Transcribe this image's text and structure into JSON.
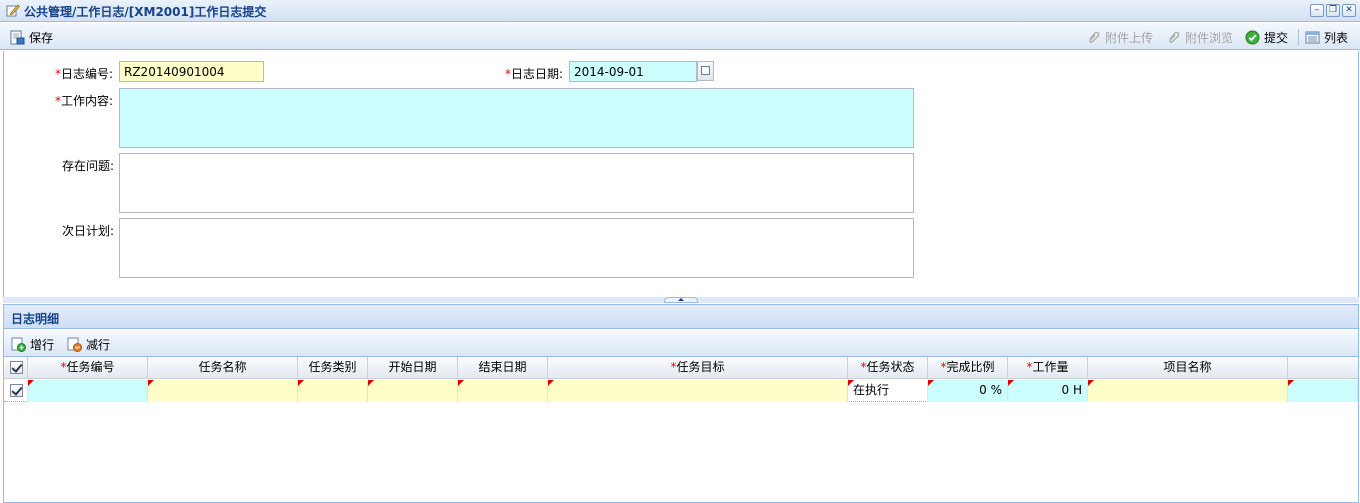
{
  "window": {
    "title": "公共管理/工作日志/[XM2001]工作日志提交"
  },
  "toolbar": {
    "save": "保存",
    "attach_upload": "附件上传",
    "attach_browse": "附件浏览",
    "submit": "提交",
    "list": "列表"
  },
  "form": {
    "log_no": {
      "label": "日志编号:",
      "value": "RZ20140901004"
    },
    "log_date": {
      "label": "日志日期:",
      "value": "2014-09-01"
    },
    "work_content": {
      "label": "工作内容:",
      "value": ""
    },
    "issues": {
      "label": "存在问题:",
      "value": ""
    },
    "next_plan": {
      "label": "次日计划:",
      "value": ""
    }
  },
  "detail": {
    "title": "日志明细",
    "add_row": "增行",
    "del_row": "减行",
    "columns": [
      {
        "label": "任务编号",
        "required": true
      },
      {
        "label": "任务名称",
        "required": false
      },
      {
        "label": "任务类别",
        "required": false
      },
      {
        "label": "开始日期",
        "required": false
      },
      {
        "label": "结束日期",
        "required": false
      },
      {
        "label": "任务目标",
        "required": true
      },
      {
        "label": "任务状态",
        "required": true
      },
      {
        "label": "完成比例",
        "required": true
      },
      {
        "label": "工作量",
        "required": true
      },
      {
        "label": "项目名称",
        "required": false
      }
    ],
    "rows": [
      {
        "checked": true,
        "cells": [
          "",
          "",
          "",
          "",
          "",
          "",
          "在执行",
          "0 %",
          "0 H",
          ""
        ]
      }
    ]
  },
  "colors": {
    "required_mark": "#e00000",
    "required_field": "#fffec8",
    "editable_field": "#cdfefe",
    "accent": "#15428b"
  }
}
